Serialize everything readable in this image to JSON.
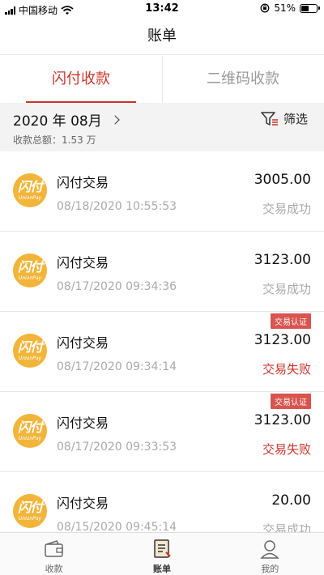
{
  "status_bar": {
    "carrier": "中国移动",
    "time": "13:42",
    "battery": "51%",
    "battery_level": 0.51
  },
  "header": {
    "title": "账单"
  },
  "tabs": [
    {
      "label": "闪付收款",
      "active": true
    },
    {
      "label": "二维码收款",
      "active": false
    }
  ],
  "summary": {
    "month": "2020 年 08月",
    "total_label": "收款总额：1.53 万",
    "filter_label": "筛选"
  },
  "transactions": [
    {
      "logo_text": "闪付",
      "logo_sub": "UnionPay",
      "title": "闪付交易",
      "time": "08/18/2020 10:55:53",
      "amount": "3005.00",
      "status": "交易成功",
      "badge": ""
    },
    {
      "logo_text": "闪付",
      "logo_sub": "UnionPay",
      "title": "闪付交易",
      "time": "08/17/2020 09:34:36",
      "amount": "3123.00",
      "status": "交易成功",
      "badge": ""
    },
    {
      "logo_text": "闪付",
      "logo_sub": "UnionPay",
      "title": "闪付交易",
      "time": "08/17/2020 09:34:14",
      "amount": "3123.00",
      "status": "交易失败",
      "badge": "交易认证"
    },
    {
      "logo_text": "闪付",
      "logo_sub": "UnionPay",
      "title": "闪付交易",
      "time": "08/17/2020 09:33:53",
      "amount": "3123.00",
      "status": "交易失败",
      "badge": "交易认证"
    },
    {
      "logo_text": "闪付",
      "logo_sub": "UnionPay",
      "title": "闪付交易",
      "time": "08/15/2020 09:45:14",
      "amount": "20.00",
      "status": "交易成功",
      "badge": ""
    }
  ],
  "tabbar": [
    {
      "label": "收款",
      "icon": "wallet-icon",
      "active": false
    },
    {
      "label": "账单",
      "icon": "bill-icon",
      "active": true
    },
    {
      "label": "我的",
      "icon": "user-icon",
      "active": false
    }
  ],
  "colors": {
    "accent": "#c8352b",
    "logo": "#f2b53a",
    "badge": "#d9534f"
  }
}
